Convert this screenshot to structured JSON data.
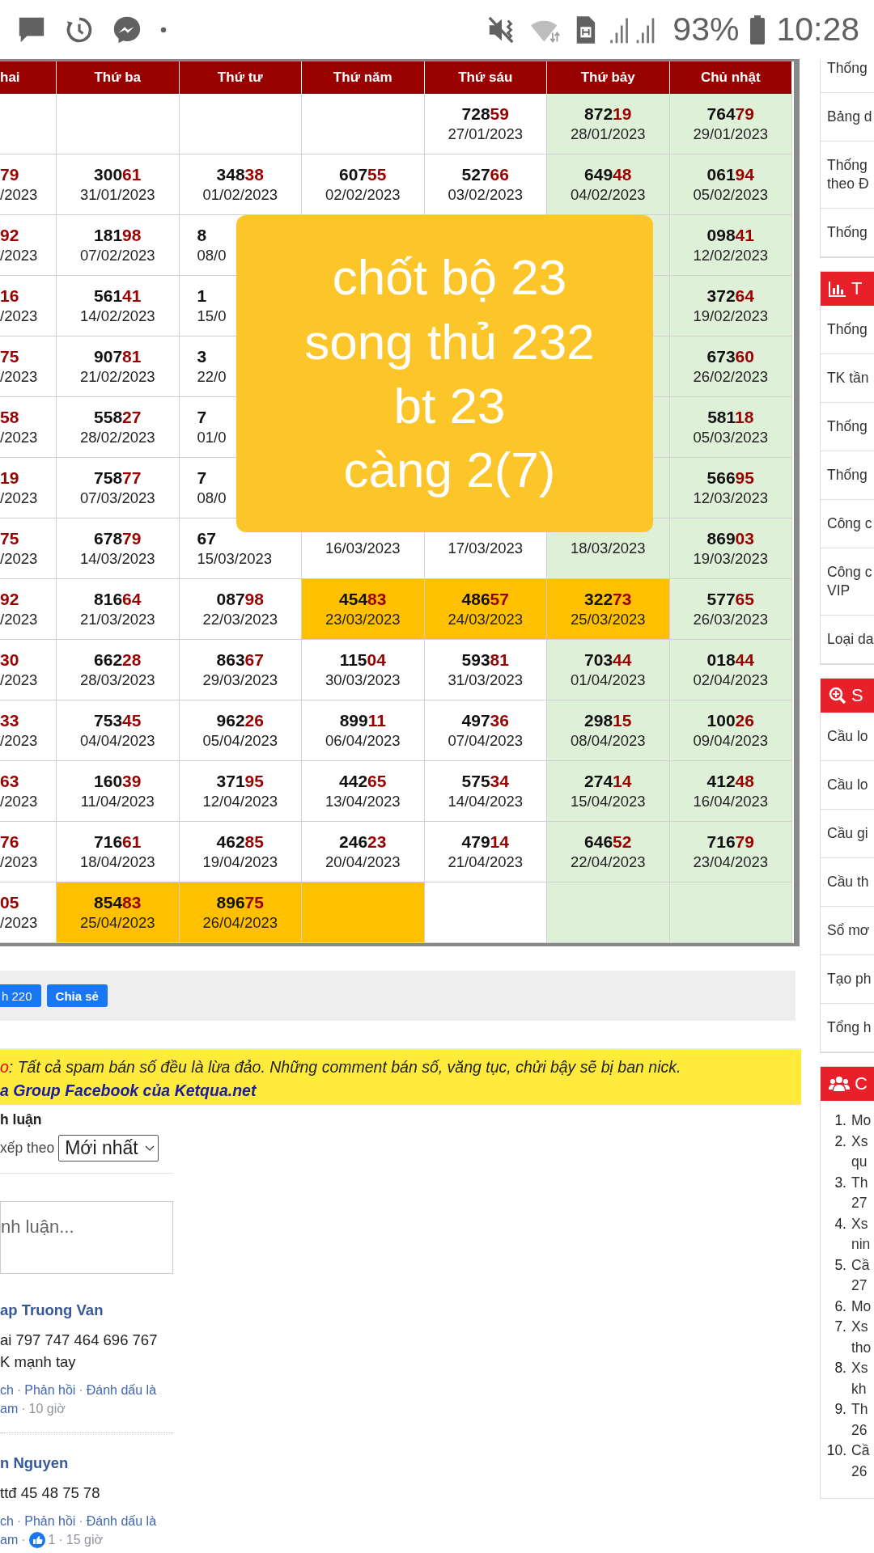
{
  "status_bar": {
    "battery": "93%",
    "time": "10:28"
  },
  "table": {
    "columns": [
      {
        "label": "hai"
      },
      {
        "label": "Thứ ba"
      },
      {
        "label": "Thứ tư"
      },
      {
        "label": "Thứ năm"
      },
      {
        "label": "Thứ sáu"
      },
      {
        "label": "Thứ bảy"
      },
      {
        "label": "Chủ nhật"
      }
    ],
    "rows": [
      {
        "cells": [
          {
            "kind": "clipped_left"
          },
          {},
          {},
          {},
          {
            "digits": "728",
            "last_two": "59",
            "date": "27/01/2023"
          },
          {
            "weekend": true,
            "digits": "872",
            "last_two": "19",
            "date": "28/01/2023"
          },
          {
            "weekend": true,
            "digits": "764",
            "last_two": "79",
            "date": "29/01/2023"
          }
        ]
      },
      {
        "cells": [
          {
            "kind": "clipped_left",
            "last_two": "79",
            "date": "/2023"
          },
          {
            "digits": "300",
            "last_two": "61",
            "date": "31/01/2023"
          },
          {
            "digits": "348",
            "last_two": "38",
            "date": "01/02/2023"
          },
          {
            "digits": "607",
            "last_two": "55",
            "date": "02/02/2023"
          },
          {
            "digits": "527",
            "last_two": "66",
            "date": "03/02/2023"
          },
          {
            "weekend": true,
            "digits": "649",
            "last_two": "48",
            "date": "04/02/2023"
          },
          {
            "weekend": true,
            "digits": "061",
            "last_two": "94",
            "date": "05/02/2023"
          }
        ]
      },
      {
        "cells": [
          {
            "kind": "clipped_left",
            "last_two": "92",
            "date": "/2023"
          },
          {
            "digits": "181",
            "last_two": "98",
            "date": "07/02/2023"
          },
          {
            "kind": "clipped_right",
            "digits": "8",
            "date": "08/0"
          },
          {},
          {},
          {
            "weekend": true
          },
          {
            "weekend": true,
            "digits": "098",
            "last_two": "41",
            "date": "12/02/2023"
          }
        ]
      },
      {
        "cells": [
          {
            "kind": "clipped_left",
            "last_two": "16",
            "date": "/2023"
          },
          {
            "digits": "561",
            "last_two": "41",
            "date": "14/02/2023"
          },
          {
            "kind": "clipped_right",
            "digits": "1",
            "date": "15/0"
          },
          {},
          {},
          {
            "weekend": true
          },
          {
            "weekend": true,
            "digits": "372",
            "last_two": "64",
            "date": "19/02/2023"
          }
        ]
      },
      {
        "cells": [
          {
            "kind": "clipped_left",
            "last_two": "75",
            "date": "/2023"
          },
          {
            "digits": "907",
            "last_two": "81",
            "date": "21/02/2023"
          },
          {
            "kind": "clipped_right",
            "digits": "3",
            "date": "22/0"
          },
          {},
          {},
          {
            "weekend": true
          },
          {
            "weekend": true,
            "digits": "673",
            "last_two": "60",
            "date": "26/02/2023"
          }
        ]
      },
      {
        "cells": [
          {
            "kind": "clipped_left",
            "last_two": "58",
            "date": "/2023"
          },
          {
            "digits": "558",
            "last_two": "27",
            "date": "28/02/2023"
          },
          {
            "kind": "clipped_right",
            "digits": "7",
            "date": "01/0"
          },
          {},
          {},
          {
            "weekend": true
          },
          {
            "weekend": true,
            "digits": "581",
            "last_two": "18",
            "date": "05/03/2023"
          }
        ]
      },
      {
        "cells": [
          {
            "kind": "clipped_left",
            "last_two": "19",
            "date": "/2023"
          },
          {
            "digits": "758",
            "last_two": "77",
            "date": "07/03/2023"
          },
          {
            "kind": "clipped_right",
            "digits": "7",
            "date": "08/0"
          },
          {},
          {},
          {
            "weekend": true
          },
          {
            "weekend": true,
            "digits": "566",
            "last_two": "95",
            "date": "12/03/2023"
          }
        ]
      },
      {
        "cells": [
          {
            "kind": "clipped_left",
            "last_two": "75",
            "date": "/2023"
          },
          {
            "digits": "678",
            "last_two": "79",
            "date": "14/03/2023"
          },
          {
            "kind": "clipped_right",
            "digits": "67",
            "date": "15/03/2023"
          },
          {
            "date": "16/03/2023"
          },
          {
            "date": "17/03/2023"
          },
          {
            "weekend": true,
            "date": "18/03/2023"
          },
          {
            "weekend": true,
            "digits": "869",
            "last_two": "03",
            "date": "19/03/2023"
          }
        ]
      },
      {
        "cells": [
          {
            "kind": "clipped_left",
            "last_two": "92",
            "date": "/2023"
          },
          {
            "digits": "816",
            "last_two": "64",
            "date": "21/03/2023"
          },
          {
            "digits": "087",
            "last_two": "98",
            "date": "22/03/2023"
          },
          {
            "highlight": true,
            "digits": "454",
            "last_two": "83",
            "date": "23/03/2023"
          },
          {
            "highlight": true,
            "digits": "486",
            "last_two": "57",
            "date": "24/03/2023"
          },
          {
            "highlight": true,
            "digits": "322",
            "last_two": "73",
            "date": "25/03/2023"
          },
          {
            "weekend": true,
            "digits": "577",
            "last_two": "65",
            "date": "26/03/2023"
          }
        ]
      },
      {
        "cells": [
          {
            "kind": "clipped_left",
            "last_two": "30",
            "date": "/2023"
          },
          {
            "digits": "662",
            "last_two": "28",
            "date": "28/03/2023"
          },
          {
            "digits": "863",
            "last_two": "67",
            "date": "29/03/2023"
          },
          {
            "digits": "115",
            "last_two": "04",
            "date": "30/03/2023"
          },
          {
            "digits": "593",
            "last_two": "81",
            "date": "31/03/2023"
          },
          {
            "weekend": true,
            "digits": "703",
            "last_two": "44",
            "date": "01/04/2023"
          },
          {
            "weekend": true,
            "digits": "018",
            "last_two": "44",
            "date": "02/04/2023"
          }
        ]
      },
      {
        "cells": [
          {
            "kind": "clipped_left",
            "last_two": "33",
            "date": "/2023"
          },
          {
            "digits": "753",
            "last_two": "45",
            "date": "04/04/2023"
          },
          {
            "digits": "962",
            "last_two": "26",
            "date": "05/04/2023"
          },
          {
            "digits": "899",
            "last_two": "11",
            "date": "06/04/2023"
          },
          {
            "digits": "497",
            "last_two": "36",
            "date": "07/04/2023"
          },
          {
            "weekend": true,
            "digits": "298",
            "last_two": "15",
            "date": "08/04/2023"
          },
          {
            "weekend": true,
            "digits": "100",
            "last_two": "26",
            "date": "09/04/2023"
          }
        ]
      },
      {
        "cells": [
          {
            "kind": "clipped_left",
            "last_two": "63",
            "date": "/2023"
          },
          {
            "digits": "160",
            "last_two": "39",
            "date": "11/04/2023"
          },
          {
            "digits": "371",
            "last_two": "95",
            "date": "12/04/2023"
          },
          {
            "digits": "442",
            "last_two": "65",
            "date": "13/04/2023"
          },
          {
            "digits": "575",
            "last_two": "34",
            "date": "14/04/2023"
          },
          {
            "weekend": true,
            "digits": "274",
            "last_two": "14",
            "date": "15/04/2023"
          },
          {
            "weekend": true,
            "digits": "412",
            "last_two": "48",
            "date": "16/04/2023"
          }
        ]
      },
      {
        "cells": [
          {
            "kind": "clipped_left",
            "last_two": "76",
            "date": "/2023"
          },
          {
            "digits": "716",
            "last_two": "61",
            "date": "18/04/2023"
          },
          {
            "digits": "462",
            "last_two": "85",
            "date": "19/04/2023"
          },
          {
            "digits": "246",
            "last_two": "23",
            "date": "20/04/2023"
          },
          {
            "digits": "479",
            "last_two": "14",
            "date": "21/04/2023"
          },
          {
            "weekend": true,
            "digits": "646",
            "last_two": "52",
            "date": "22/04/2023"
          },
          {
            "weekend": true,
            "digits": "716",
            "last_two": "79",
            "date": "23/04/2023"
          }
        ]
      },
      {
        "cells": [
          {
            "kind": "clipped_left",
            "last_two": "05",
            "date": "/2023"
          },
          {
            "highlight": true,
            "digits": "854",
            "last_two": "83",
            "date": "25/04/2023"
          },
          {
            "highlight": true,
            "digits": "896",
            "last_two": "75",
            "date": "26/04/2023"
          },
          {
            "highlight": true
          },
          {},
          {
            "weekend": true
          },
          {
            "weekend": true
          }
        ]
      }
    ]
  },
  "overlay": {
    "lines": [
      "chốt bộ 23",
      "song thủ 232",
      "bt 23",
      "càng 2(7)"
    ]
  },
  "share_bar": {
    "buttons": [
      {
        "label": "h 220"
      },
      {
        "label": "Chia sẻ"
      }
    ]
  },
  "notice": {
    "lead": "o",
    "text": ": Tất cả spam bán số đều là lừa đảo. Những comment bán số, văng tục, chửi bậy sẽ bị ban nick.",
    "link": "a Group Facebook của Ketqua.net"
  },
  "comments": {
    "title": "h luận",
    "sort_label": "xếp theo",
    "sort_value": "Mới nhất",
    "input_placeholder": "nh luận...",
    "separator": "·",
    "items": [
      {
        "author": "ap Truong Van",
        "lines": [
          "ai 797 747 464 696 767",
          "K mạnh tay"
        ],
        "action_rows": [
          [
            "ch",
            "Phản hồi",
            "Đánh dấu là"
          ],
          [
            "am"
          ]
        ],
        "time": "10 giờ"
      },
      {
        "author": "n Nguyen",
        "lines": [
          "ttđ 45 48 75 78"
        ],
        "action_rows": [
          [
            "ch",
            "Phản hồi",
            "Đánh dấu là"
          ],
          [
            "am"
          ]
        ],
        "likes": "1",
        "time": "15 giờ"
      }
    ]
  },
  "sidebar": {
    "sections": [
      {
        "kind": "links",
        "items": [
          {
            "lines": [
              "Thống"
            ]
          },
          {
            "lines": [
              "Bảng d"
            ]
          },
          {
            "lines": [
              "Thống",
              "theo Đ"
            ]
          },
          {
            "lines": [
              "Thống"
            ]
          }
        ]
      },
      {
        "kind": "links",
        "header": "T",
        "items": [
          {
            "lines": [
              "Thống"
            ]
          },
          {
            "lines": [
              "TK tần"
            ]
          },
          {
            "lines": [
              "Thống"
            ]
          },
          {
            "lines": [
              "Thống"
            ]
          },
          {
            "lines": [
              "Công c"
            ]
          },
          {
            "lines": [
              "Công c",
              "VIP"
            ]
          },
          {
            "lines": [
              "Loại da"
            ]
          }
        ]
      },
      {
        "kind": "links",
        "header": "S",
        "items": [
          {
            "lines": [
              "Cầu lo"
            ]
          },
          {
            "lines": [
              "Cầu lo"
            ]
          },
          {
            "lines": [
              "Cầu gi"
            ]
          },
          {
            "lines": [
              "Cầu th"
            ]
          },
          {
            "lines": [
              "Sổ mơ"
            ]
          },
          {
            "lines": [
              "Tạo ph"
            ]
          },
          {
            "lines": [
              "Tổng h"
            ]
          }
        ]
      },
      {
        "kind": "ranked",
        "header": "C",
        "items": [
          {
            "number": "1.",
            "lines": [
              "Mo"
            ]
          },
          {
            "number": "2.",
            "lines": [
              "Xs",
              "qu"
            ]
          },
          {
            "number": "3.",
            "lines": [
              "Th",
              "27"
            ]
          },
          {
            "number": "4.",
            "lines": [
              "Xs",
              "nin"
            ]
          },
          {
            "number": "5.",
            "lines": [
              "Cầ",
              "27"
            ]
          },
          {
            "number": "6.",
            "lines": [
              "Mo"
            ]
          },
          {
            "number": "7.",
            "lines": [
              "Xs",
              "tho"
            ]
          },
          {
            "number": "8.",
            "lines": [
              "Xs",
              "kh"
            ]
          },
          {
            "number": "9.",
            "lines": [
              "Th",
              "26"
            ]
          },
          {
            "number": "10.",
            "lines": [
              "Cầ",
              "26"
            ]
          }
        ]
      }
    ]
  }
}
